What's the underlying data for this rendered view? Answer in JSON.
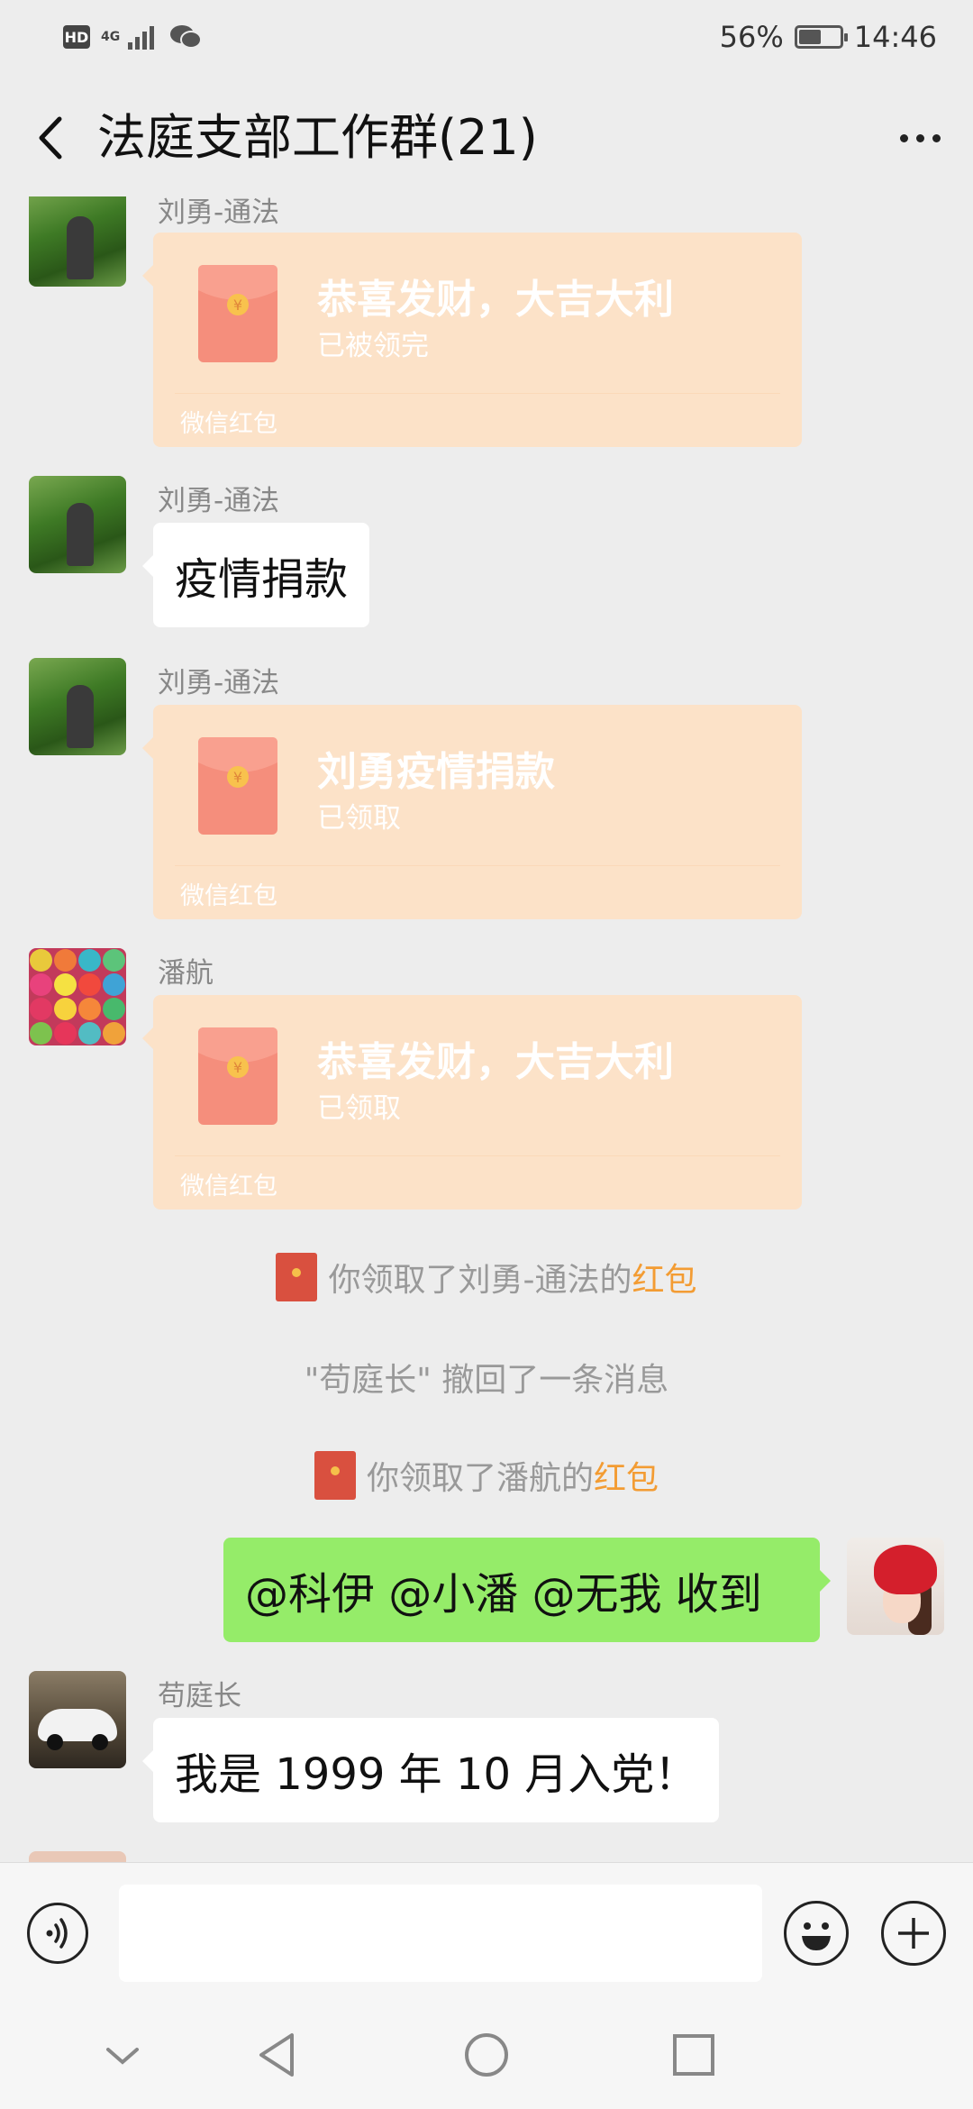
{
  "status_bar": {
    "hd": "HD",
    "network": "4G",
    "battery": "56%",
    "battery_level": 0.56,
    "time": "14:46"
  },
  "header": {
    "title": "法庭支部工作群(21)"
  },
  "messages": [
    {
      "sender": "刘勇-通法",
      "type": "redpacket",
      "title": "恭喜发财，大吉大利",
      "status": "已被领完",
      "footer": "微信红包"
    },
    {
      "sender": "刘勇-通法",
      "type": "text",
      "text": "疫情捐款"
    },
    {
      "sender": "刘勇-通法",
      "type": "redpacket",
      "title": "刘勇疫情捐款",
      "status": "已领取",
      "footer": "微信红包"
    },
    {
      "sender": "潘航",
      "type": "redpacket",
      "title": "恭喜发财，大吉大利",
      "status": "已领取",
      "footer": "微信红包"
    }
  ],
  "system_messages": [
    {
      "prefix": "你领取了刘勇-通法的",
      "link": "红包"
    },
    {
      "text": "\"苟庭长\" 撤回了一条消息"
    },
    {
      "prefix": "你领取了潘航的",
      "link": "红包"
    }
  ],
  "my_message": {
    "text": "@科伊 @小潘 @无我  收到"
  },
  "last_message": {
    "sender": "苟庭长",
    "text": "我是 1999 年 10 月入党！"
  },
  "input": {
    "value": ""
  },
  "icons": {
    "back": "back-arrow-icon",
    "more": "more-icon",
    "voice": "voice-icon",
    "emoji": "emoji-icon",
    "plus": "plus-icon",
    "coin": "¥"
  },
  "colors": {
    "self_bubble": "#95ec69",
    "redpacket": "#fce2c8",
    "link": "#f39c33",
    "background": "#ededed"
  }
}
